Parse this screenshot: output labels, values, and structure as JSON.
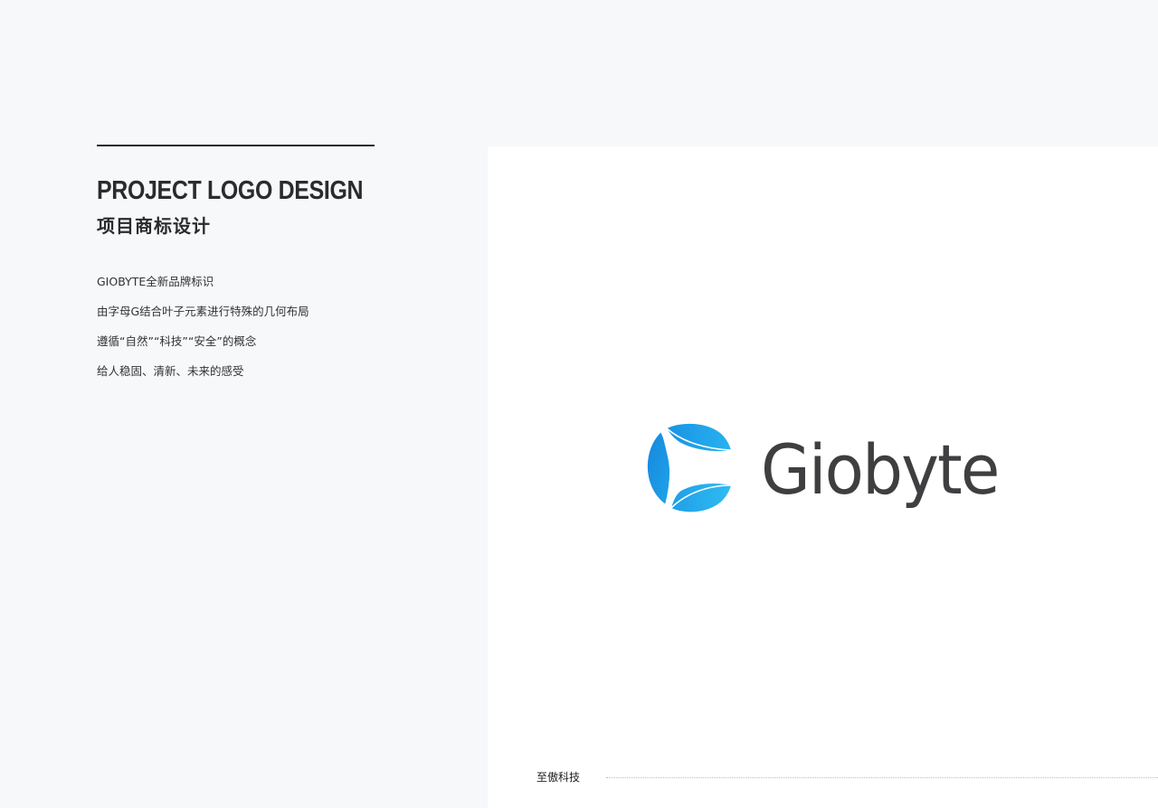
{
  "header": {
    "title_en": "PROJECT LOGO DESIGN",
    "title_cn": "项目商标设计"
  },
  "description": {
    "lines": [
      "GIOBYTE全新品牌标识",
      "由字母G结合叶子元素进行特殊的几何布局",
      "遵循“自然”“科技”“安全”的概念",
      "给人稳固、清新、未来的感受"
    ]
  },
  "logo": {
    "wordmark": "Giobyte",
    "mark_icon": "leaf-g-icon",
    "colors": {
      "mark_primary": "#1a9be6",
      "mark_light": "#29b6f0",
      "wordmark": "#3f3f41"
    }
  },
  "footer": {
    "label": "至傲科技"
  },
  "colors": {
    "page_background": "#f7f8fa",
    "panel_background": "#ffffff",
    "text": "#2b2b2b"
  }
}
